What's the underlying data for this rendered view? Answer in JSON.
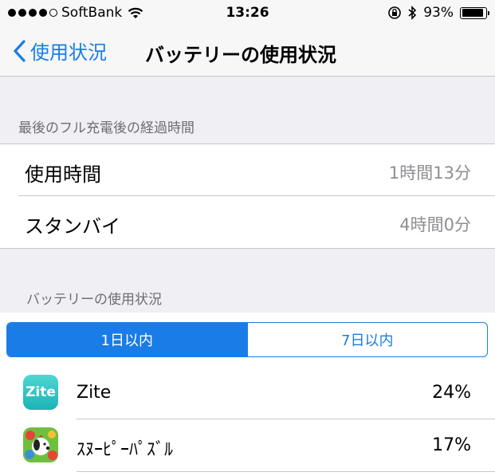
{
  "status": {
    "carrier": "SoftBank",
    "time": "13:26",
    "battery_text": "93%",
    "battery_level": 0.93
  },
  "nav": {
    "back_label": "使用状況",
    "title": "バッテリーの使用状況"
  },
  "section1": {
    "header": "最後のフル充電後の経過時間",
    "rows": [
      {
        "label": "使用時間",
        "value": "1時間13分"
      },
      {
        "label": "スタンバイ",
        "value": "4時間0分"
      }
    ]
  },
  "section2": {
    "header": "バッテリーの使用状況",
    "tabs": [
      {
        "label": "1日以内"
      },
      {
        "label": "7日以内"
      }
    ],
    "apps": [
      {
        "icon_text": "Zite",
        "name": "Zite",
        "percent": "24%"
      },
      {
        "name": "ｽﾇｰﾋﾟｰﾊﾟｽﾞﾙ",
        "percent": "17%"
      }
    ]
  },
  "colors": {
    "accent": "#1a7ce6",
    "background": "#efeff4",
    "secondary_text": "#8e8e93"
  }
}
